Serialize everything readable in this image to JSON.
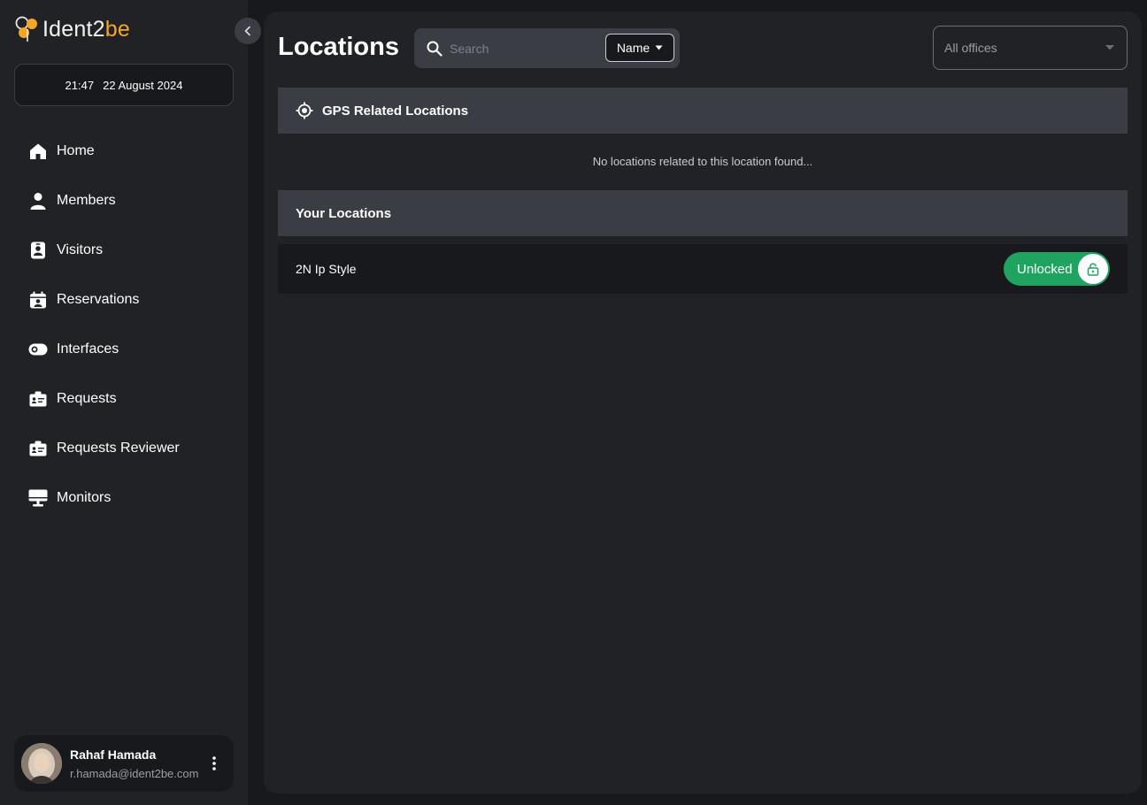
{
  "app": {
    "logo_part1": "Ident2",
    "logo_part2": "be",
    "brand_color": "#f5a623",
    "accent_success": "#1fa361"
  },
  "clock": {
    "time": "21:47",
    "date": "22 August 2024"
  },
  "sidebar": {
    "items": [
      {
        "label": "Home",
        "icon": "home-icon"
      },
      {
        "label": "Members",
        "icon": "person-icon"
      },
      {
        "label": "Visitors",
        "icon": "badge-icon"
      },
      {
        "label": "Reservations",
        "icon": "calendar-icon"
      },
      {
        "label": "Interfaces",
        "icon": "toggle-icon"
      },
      {
        "label": "Requests",
        "icon": "id-card-icon"
      },
      {
        "label": "Requests Reviewer",
        "icon": "id-card-icon"
      },
      {
        "label": "Monitors",
        "icon": "monitor-icon"
      }
    ]
  },
  "user": {
    "name": "Rahaf Hamada",
    "email": "r.hamada@ident2be.com"
  },
  "header": {
    "title": "Locations",
    "search_placeholder": "Search",
    "filter_by": "Name",
    "office_select": "All offices"
  },
  "gps_section": {
    "title": "GPS Related Locations",
    "empty_message": "No locations related to this location found..."
  },
  "your_locations": {
    "title": "Your Locations",
    "items": [
      {
        "name": "2N Ip Style",
        "status": "Unlocked"
      }
    ]
  }
}
